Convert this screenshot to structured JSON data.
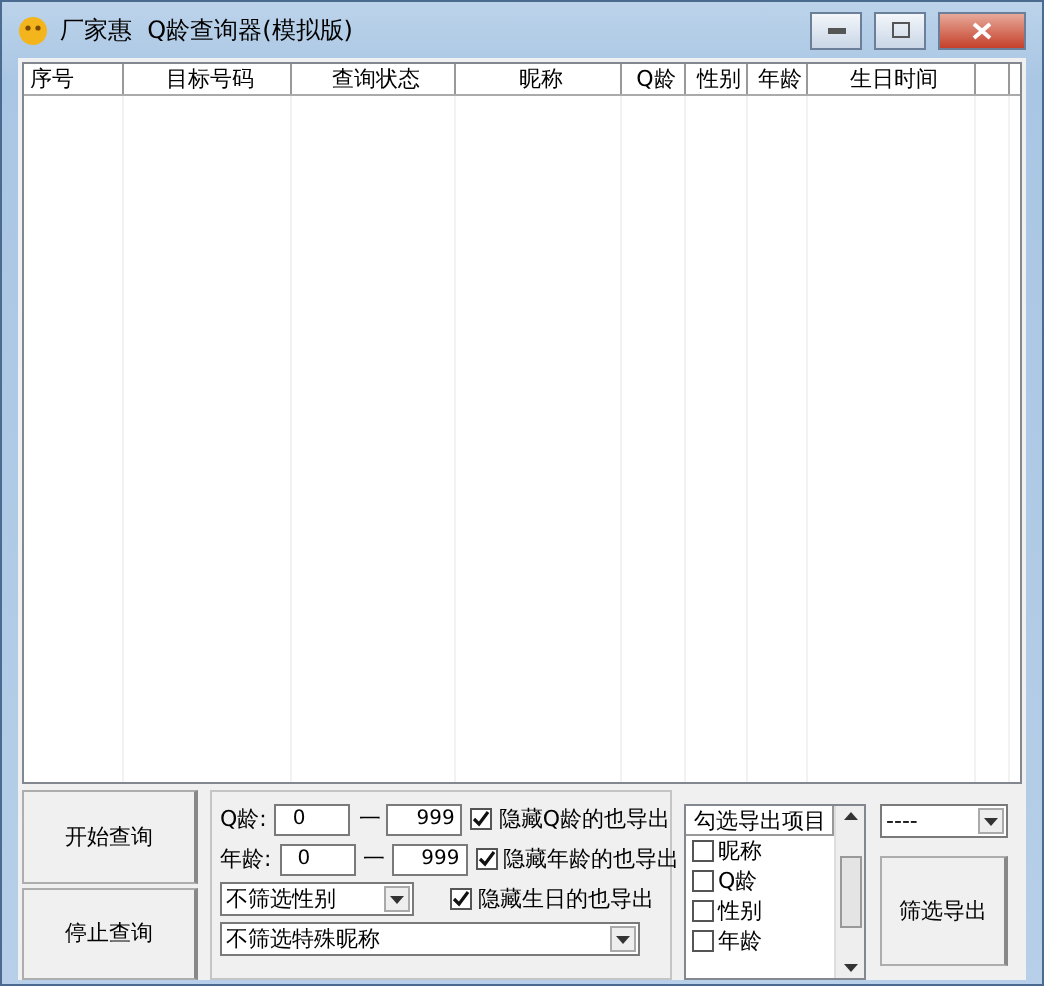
{
  "window": {
    "title": "厂家惠  Q龄查询器(模拟版)"
  },
  "table": {
    "columns": [
      "序号",
      "目标号码",
      "查询状态",
      "昵称",
      "Q龄",
      "性别",
      "年龄",
      "生日时间"
    ]
  },
  "buttons": {
    "start": "开始查询",
    "stop": "停止查询",
    "export": "筛选导出"
  },
  "filters": {
    "q_age": {
      "label": "Q龄:",
      "from": "0",
      "sep": "一",
      "to": "999"
    },
    "age": {
      "label": "年龄:",
      "from": "0",
      "sep": "一",
      "to": "999"
    },
    "gender": "不筛选性别",
    "nickname": "不筛选特殊昵称",
    "options": [
      {
        "label": "隐藏Q龄的也导出",
        "checked": true
      },
      {
        "label": "隐藏年龄的也导出",
        "checked": true
      },
      {
        "label": "隐藏生日的也导出",
        "checked": true
      }
    ]
  },
  "export_list": {
    "header": "勾选导出项目",
    "items": [
      {
        "label": "昵称",
        "checked": false
      },
      {
        "label": "Q龄",
        "checked": false
      },
      {
        "label": "性别",
        "checked": false
      },
      {
        "label": "年龄",
        "checked": false
      }
    ]
  },
  "export_select": "----"
}
